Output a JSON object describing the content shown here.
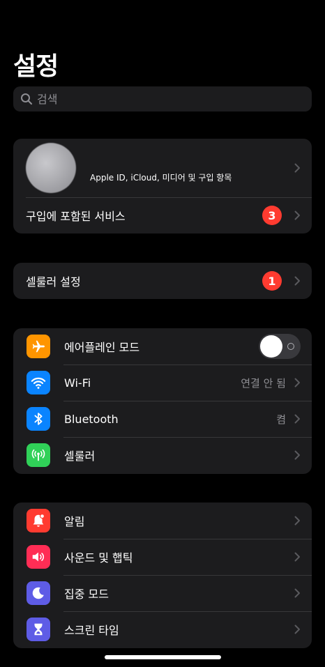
{
  "header": {
    "title": "설정"
  },
  "search": {
    "placeholder": "검색"
  },
  "profile": {
    "name": "",
    "subtitle": "Apple ID, iCloud, 미디어 및 구입 항목",
    "services_label": "구입에 포함된 서비스",
    "services_badge": "3"
  },
  "cellular_setup": {
    "label": "셀룰러 설정",
    "badge": "1"
  },
  "connectivity": {
    "items": [
      {
        "label": "에어플레인 모드",
        "icon": "airplane-icon",
        "color": "#ff9500",
        "toggle": false
      },
      {
        "label": "Wi-Fi",
        "icon": "wifi-icon",
        "color": "#0a84ff",
        "value": "연결 안 됨"
      },
      {
        "label": "Bluetooth",
        "icon": "bluetooth-icon",
        "color": "#0a84ff",
        "value": "켬"
      },
      {
        "label": "셀룰러",
        "icon": "cellular-icon",
        "color": "#30d158"
      }
    ]
  },
  "notifications": {
    "items": [
      {
        "label": "알림",
        "icon": "bell-icon",
        "color": "#ff3b30"
      },
      {
        "label": "사운드 및 햅틱",
        "icon": "speaker-icon",
        "color": "#ff2d55"
      },
      {
        "label": "집중 모드",
        "icon": "moon-icon",
        "color": "#5e5ce6"
      },
      {
        "label": "스크린 타임",
        "icon": "hourglass-icon",
        "color": "#5e5ce6"
      }
    ]
  }
}
